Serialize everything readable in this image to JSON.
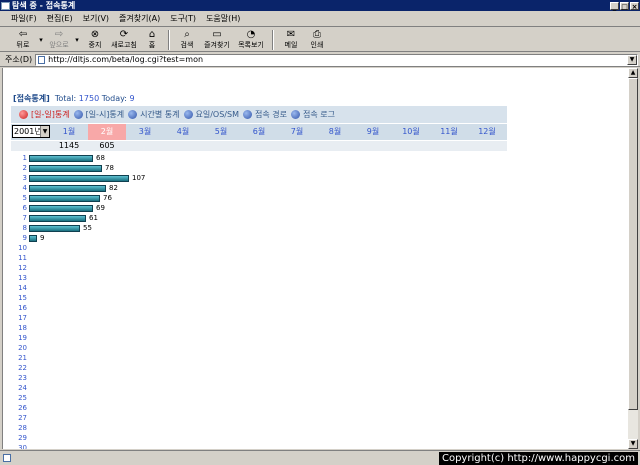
{
  "window": {
    "title": "탐색 중 - 접속통계"
  },
  "menu": [
    "파일(F)",
    "편집(E)",
    "보기(V)",
    "즐겨찾기(A)",
    "도구(T)",
    "도움말(H)"
  ],
  "toolbar": {
    "back": "뒤로",
    "forward": "앞으로",
    "stop": "중지",
    "refresh": "새로고침",
    "home": "홈",
    "search": "검색",
    "favorites": "즐겨찾기",
    "history": "목록보기",
    "mail": "메일",
    "print": "인쇄"
  },
  "address": {
    "label": "주소(D)",
    "url": "http://dltjs.com/beta/log.cgi?test=mon"
  },
  "stats": {
    "heading": "[접속통계]",
    "total_label": "Total:",
    "total": "1750",
    "today_label": "Today:",
    "today": "9"
  },
  "tabs": [
    {
      "label": "[일-일]통계",
      "selected": true
    },
    {
      "label": "[일-시]통계",
      "selected": false
    },
    {
      "label": "시간별 통계",
      "selected": false
    },
    {
      "label": "요일/OS/SM",
      "selected": false
    },
    {
      "label": "접속 경로",
      "selected": false
    },
    {
      "label": "접속 로그",
      "selected": false
    }
  ],
  "year": "2001년",
  "months": [
    "1월",
    "2월",
    "3월",
    "4월",
    "5월",
    "6월",
    "7월",
    "8월",
    "9월",
    "10월",
    "11월",
    "12월"
  ],
  "active_month": 1,
  "month_counts": [
    "1145",
    "605",
    "",
    "",
    "",
    "",
    "",
    "",
    "",
    "",
    "",
    ""
  ],
  "chart_data": {
    "type": "bar",
    "orientation": "horizontal",
    "categories": [
      "1",
      "2",
      "3",
      "4",
      "5",
      "6",
      "7",
      "8",
      "9",
      "10",
      "11",
      "12",
      "13",
      "14",
      "15",
      "16",
      "17",
      "18",
      "19",
      "20",
      "21",
      "22",
      "23",
      "24",
      "25",
      "26",
      "27",
      "28",
      "29",
      "30"
    ],
    "values": [
      68,
      78,
      107,
      82,
      76,
      69,
      61,
      55,
      9,
      null,
      null,
      null,
      null,
      null,
      null,
      null,
      null,
      null,
      null,
      null,
      null,
      null,
      null,
      null,
      null,
      null,
      null,
      null,
      null,
      null
    ],
    "bar_color": "#2a8c9c"
  },
  "colors": {
    "accent": "#3355cc",
    "active_month": "#f8a8a8",
    "selected_tab": "#cc2222",
    "tab_bg": "#d7e2ec"
  },
  "statusbar": {
    "copyright": "Copyright(c) http://www.happycgi.com"
  }
}
